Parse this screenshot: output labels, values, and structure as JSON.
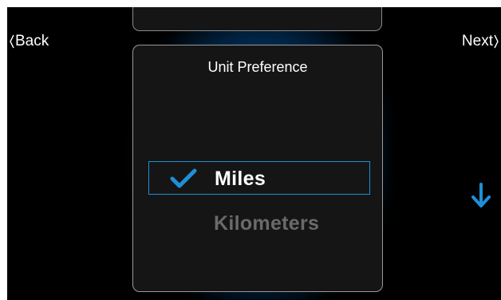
{
  "nav": {
    "back_label": "Back",
    "next_label": "Next"
  },
  "panel": {
    "title": "Unit Preference",
    "options": [
      {
        "label": "Miles",
        "selected": true
      },
      {
        "label": "Kilometers",
        "selected": false
      }
    ]
  },
  "icons": {
    "check": "check-icon",
    "scroll_down": "arrow-down-icon",
    "back": "chevron-left-icon",
    "next": "chevron-right-icon"
  },
  "colors": {
    "accent": "#1e8fd6",
    "background": "#000000",
    "panel": "#151515",
    "unselected_text": "#6a6a6a"
  }
}
